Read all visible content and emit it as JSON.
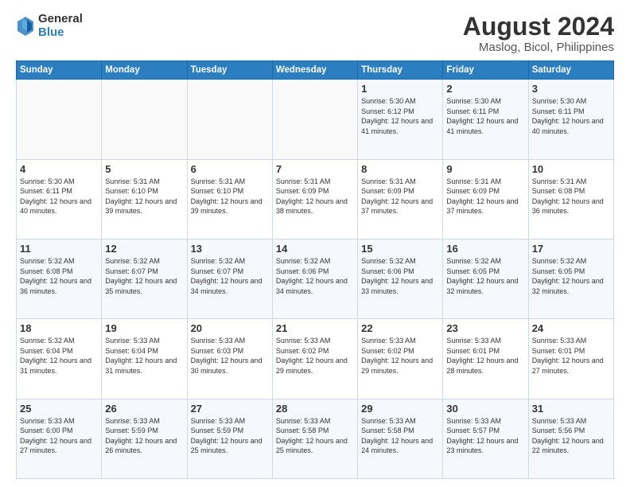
{
  "logo": {
    "general": "General",
    "blue": "Blue"
  },
  "title": "August 2024",
  "subtitle": "Maslog, Bicol, Philippines",
  "weekdays": [
    "Sunday",
    "Monday",
    "Tuesday",
    "Wednesday",
    "Thursday",
    "Friday",
    "Saturday"
  ],
  "weeks": [
    [
      {
        "day": "",
        "sunrise": "",
        "sunset": "",
        "daylight": ""
      },
      {
        "day": "",
        "sunrise": "",
        "sunset": "",
        "daylight": ""
      },
      {
        "day": "",
        "sunrise": "",
        "sunset": "",
        "daylight": ""
      },
      {
        "day": "",
        "sunrise": "",
        "sunset": "",
        "daylight": ""
      },
      {
        "day": "1",
        "sunrise": "Sunrise: 5:30 AM",
        "sunset": "Sunset: 6:12 PM",
        "daylight": "Daylight: 12 hours and 41 minutes."
      },
      {
        "day": "2",
        "sunrise": "Sunrise: 5:30 AM",
        "sunset": "Sunset: 6:11 PM",
        "daylight": "Daylight: 12 hours and 41 minutes."
      },
      {
        "day": "3",
        "sunrise": "Sunrise: 5:30 AM",
        "sunset": "Sunset: 6:11 PM",
        "daylight": "Daylight: 12 hours and 40 minutes."
      }
    ],
    [
      {
        "day": "4",
        "sunrise": "Sunrise: 5:30 AM",
        "sunset": "Sunset: 6:11 PM",
        "daylight": "Daylight: 12 hours and 40 minutes."
      },
      {
        "day": "5",
        "sunrise": "Sunrise: 5:31 AM",
        "sunset": "Sunset: 6:10 PM",
        "daylight": "Daylight: 12 hours and 39 minutes."
      },
      {
        "day": "6",
        "sunrise": "Sunrise: 5:31 AM",
        "sunset": "Sunset: 6:10 PM",
        "daylight": "Daylight: 12 hours and 39 minutes."
      },
      {
        "day": "7",
        "sunrise": "Sunrise: 5:31 AM",
        "sunset": "Sunset: 6:09 PM",
        "daylight": "Daylight: 12 hours and 38 minutes."
      },
      {
        "day": "8",
        "sunrise": "Sunrise: 5:31 AM",
        "sunset": "Sunset: 6:09 PM",
        "daylight": "Daylight: 12 hours and 37 minutes."
      },
      {
        "day": "9",
        "sunrise": "Sunrise: 5:31 AM",
        "sunset": "Sunset: 6:09 PM",
        "daylight": "Daylight: 12 hours and 37 minutes."
      },
      {
        "day": "10",
        "sunrise": "Sunrise: 5:31 AM",
        "sunset": "Sunset: 6:08 PM",
        "daylight": "Daylight: 12 hours and 36 minutes."
      }
    ],
    [
      {
        "day": "11",
        "sunrise": "Sunrise: 5:32 AM",
        "sunset": "Sunset: 6:08 PM",
        "daylight": "Daylight: 12 hours and 36 minutes."
      },
      {
        "day": "12",
        "sunrise": "Sunrise: 5:32 AM",
        "sunset": "Sunset: 6:07 PM",
        "daylight": "Daylight: 12 hours and 35 minutes."
      },
      {
        "day": "13",
        "sunrise": "Sunrise: 5:32 AM",
        "sunset": "Sunset: 6:07 PM",
        "daylight": "Daylight: 12 hours and 34 minutes."
      },
      {
        "day": "14",
        "sunrise": "Sunrise: 5:32 AM",
        "sunset": "Sunset: 6:06 PM",
        "daylight": "Daylight: 12 hours and 34 minutes."
      },
      {
        "day": "15",
        "sunrise": "Sunrise: 5:32 AM",
        "sunset": "Sunset: 6:06 PM",
        "daylight": "Daylight: 12 hours and 33 minutes."
      },
      {
        "day": "16",
        "sunrise": "Sunrise: 5:32 AM",
        "sunset": "Sunset: 6:05 PM",
        "daylight": "Daylight: 12 hours and 32 minutes."
      },
      {
        "day": "17",
        "sunrise": "Sunrise: 5:32 AM",
        "sunset": "Sunset: 6:05 PM",
        "daylight": "Daylight: 12 hours and 32 minutes."
      }
    ],
    [
      {
        "day": "18",
        "sunrise": "Sunrise: 5:32 AM",
        "sunset": "Sunset: 6:04 PM",
        "daylight": "Daylight: 12 hours and 31 minutes."
      },
      {
        "day": "19",
        "sunrise": "Sunrise: 5:33 AM",
        "sunset": "Sunset: 6:04 PM",
        "daylight": "Daylight: 12 hours and 31 minutes."
      },
      {
        "day": "20",
        "sunrise": "Sunrise: 5:33 AM",
        "sunset": "Sunset: 6:03 PM",
        "daylight": "Daylight: 12 hours and 30 minutes."
      },
      {
        "day": "21",
        "sunrise": "Sunrise: 5:33 AM",
        "sunset": "Sunset: 6:02 PM",
        "daylight": "Daylight: 12 hours and 29 minutes."
      },
      {
        "day": "22",
        "sunrise": "Sunrise: 5:33 AM",
        "sunset": "Sunset: 6:02 PM",
        "daylight": "Daylight: 12 hours and 29 minutes."
      },
      {
        "day": "23",
        "sunrise": "Sunrise: 5:33 AM",
        "sunset": "Sunset: 6:01 PM",
        "daylight": "Daylight: 12 hours and 28 minutes."
      },
      {
        "day": "24",
        "sunrise": "Sunrise: 5:33 AM",
        "sunset": "Sunset: 6:01 PM",
        "daylight": "Daylight: 12 hours and 27 minutes."
      }
    ],
    [
      {
        "day": "25",
        "sunrise": "Sunrise: 5:33 AM",
        "sunset": "Sunset: 6:00 PM",
        "daylight": "Daylight: 12 hours and 27 minutes."
      },
      {
        "day": "26",
        "sunrise": "Sunrise: 5:33 AM",
        "sunset": "Sunset: 5:59 PM",
        "daylight": "Daylight: 12 hours and 26 minutes."
      },
      {
        "day": "27",
        "sunrise": "Sunrise: 5:33 AM",
        "sunset": "Sunset: 5:59 PM",
        "daylight": "Daylight: 12 hours and 25 minutes."
      },
      {
        "day": "28",
        "sunrise": "Sunrise: 5:33 AM",
        "sunset": "Sunset: 5:58 PM",
        "daylight": "Daylight: 12 hours and 25 minutes."
      },
      {
        "day": "29",
        "sunrise": "Sunrise: 5:33 AM",
        "sunset": "Sunset: 5:58 PM",
        "daylight": "Daylight: 12 hours and 24 minutes."
      },
      {
        "day": "30",
        "sunrise": "Sunrise: 5:33 AM",
        "sunset": "Sunset: 5:57 PM",
        "daylight": "Daylight: 12 hours and 23 minutes."
      },
      {
        "day": "31",
        "sunrise": "Sunrise: 5:33 AM",
        "sunset": "Sunset: 5:56 PM",
        "daylight": "Daylight: 12 hours and 22 minutes."
      }
    ]
  ]
}
